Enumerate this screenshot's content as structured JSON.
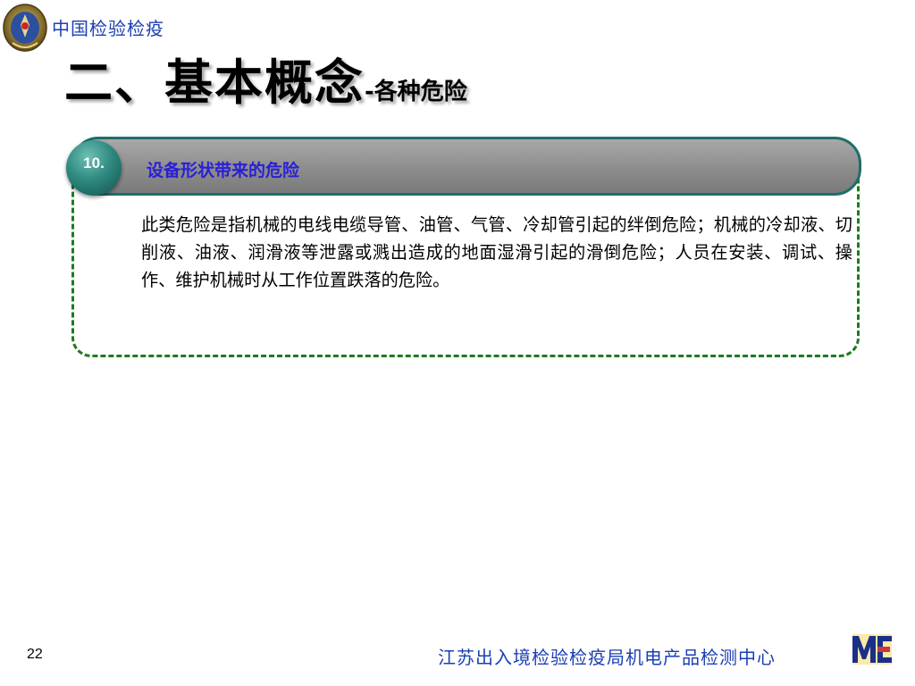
{
  "header": {
    "org_name": "中国检验检疫"
  },
  "title": {
    "main": "二、基本概念",
    "sub": "-各种危险"
  },
  "section": {
    "number": "10.",
    "heading": "设备形状带来的危险",
    "body": "此类危险是指机械的电线电缆导管、油管、气管、冷却管引起的绊倒危险；机械的冷却液、切削液、油液、润滑液等泄露或溅出造成的地面湿滑引起的滑倒危险；人员在安装、调试、操作、维护机械时从工作位置跌落的危险。"
  },
  "footer": {
    "page_number": "22",
    "org_name": "江苏出入境检验检疫局机电产品检测中心",
    "logo_text": "ME"
  },
  "colors": {
    "org_blue": "#1b3fb3",
    "heading_blue": "#2a1fd6",
    "frame_green": "#1f7a1f",
    "bar_gray": "#8d8d8d",
    "badge_teal": "#2f8a80"
  },
  "icons": {
    "emblem": "customs-emblem-icon",
    "logo": "me-logo-icon"
  }
}
